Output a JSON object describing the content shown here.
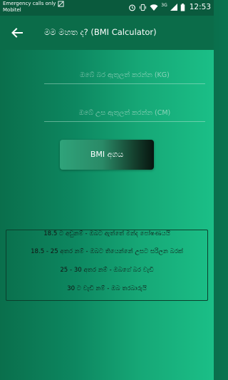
{
  "status_bar": {
    "notice": "Emergency calls only",
    "carrier": "Mobitel",
    "network": "3G",
    "time": "12:53"
  },
  "app_bar": {
    "title": "මම මහත ද? (BMI Calculator)"
  },
  "form": {
    "weight_placeholder": "ඔබේ බර ඇතුලත් කරන්න (KG)",
    "height_placeholder": "ඔබේ උස ඇතුලත් කරන්න (CM)",
    "button_label": "BMI අගය"
  },
  "ranges": [
    "18.5 ට අඩුනම් - ඔබට ඇත්තේ මන්ද පෝෂණයයි",
    "18.5 - 25 අතර නම් - ඔබට තියෙන්නේ උසට සරිලන බරක්",
    "25 - 30 අතර නම් - ඔබගේ බර වැඩි",
    "30 ට වැඩි නම් - ඔබ තරබාරුයි"
  ],
  "colors": {
    "status_bar": "#0a5a3d",
    "app_bar": "#0b6c49",
    "background_start": "#0a6f4c",
    "background_end": "#1bbf87"
  }
}
